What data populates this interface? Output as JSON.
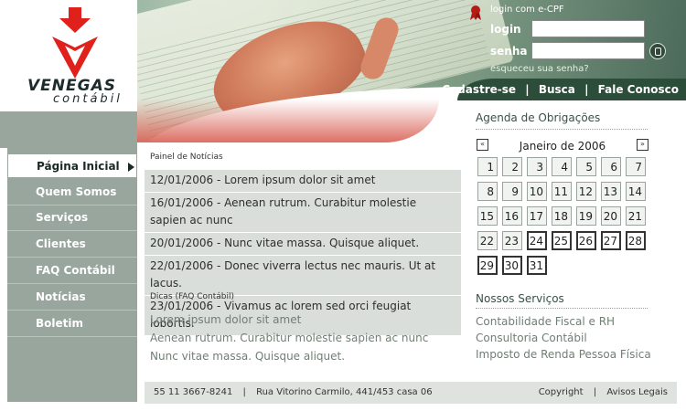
{
  "brand": {
    "name_line1": "VENEGAS",
    "name_line2": "contábil",
    "red": "#e0201a",
    "green": "#2d4d3b",
    "sidebar_grey": "#98a69d"
  },
  "login": {
    "ecpf_link": "login com e-CPF",
    "login_label": "login",
    "senha_label": "senha",
    "login_value": "",
    "senha_value": "",
    "forgot": "esqueceu sua senha?"
  },
  "topnav": {
    "items": [
      "Cadastre-se",
      "Busca",
      "Fale Conosco"
    ],
    "separator": "|"
  },
  "sidebar": {
    "items": [
      {
        "label": "Página Inicial",
        "active": true
      },
      {
        "label": "Quem Somos"
      },
      {
        "label": "Serviços"
      },
      {
        "label": "Clientes"
      },
      {
        "label": "FAQ Contábil"
      },
      {
        "label": "Notícias"
      },
      {
        "label": "Boletim"
      }
    ]
  },
  "news": {
    "title": "Painel de Notícias",
    "items": [
      "12/01/2006 - Lorem ipsum dolor sit amet",
      "16/01/2006 - Aenean rutrum. Curabitur molestie sapien ac nunc",
      "20/01/2006 - Nunc vitae massa. Quisque aliquet.",
      "22/01/2006 - Donec viverra lectus nec mauris. Ut at lacus.",
      "23/01/2006 - Vivamus ac lorem sed orci feugiat lobortis."
    ]
  },
  "faq": {
    "title": "Dicas (FAQ Contábil)",
    "items": [
      "Lorem ipsum dolor sit amet",
      "Aenean rutrum. Curabitur molestie sapien ac nunc",
      "Nunc vitae massa. Quisque aliquet."
    ]
  },
  "agenda": {
    "title": "Agenda de Obrigações",
    "prev": "«",
    "next": "»",
    "month": "Janeiro de 2006",
    "days": [
      1,
      2,
      3,
      4,
      5,
      6,
      7,
      8,
      9,
      10,
      11,
      12,
      13,
      14,
      15,
      16,
      17,
      18,
      19,
      20,
      21,
      22,
      23,
      24,
      25,
      26,
      27,
      28,
      29,
      30,
      31
    ],
    "highlighted_from": 24
  },
  "services": {
    "title": "Nossos Serviços",
    "items": [
      "Contabilidade Fiscal e RH",
      "Consultoria Contábil",
      "Imposto de Renda Pessoa Física"
    ]
  },
  "footer": {
    "phone": "55 11 3667-8241",
    "address": "Rua Vitorino Carmilo, 441/453 casa 06",
    "copyright": "Copyright",
    "legal": "Avisos Legais",
    "separator": "|"
  }
}
